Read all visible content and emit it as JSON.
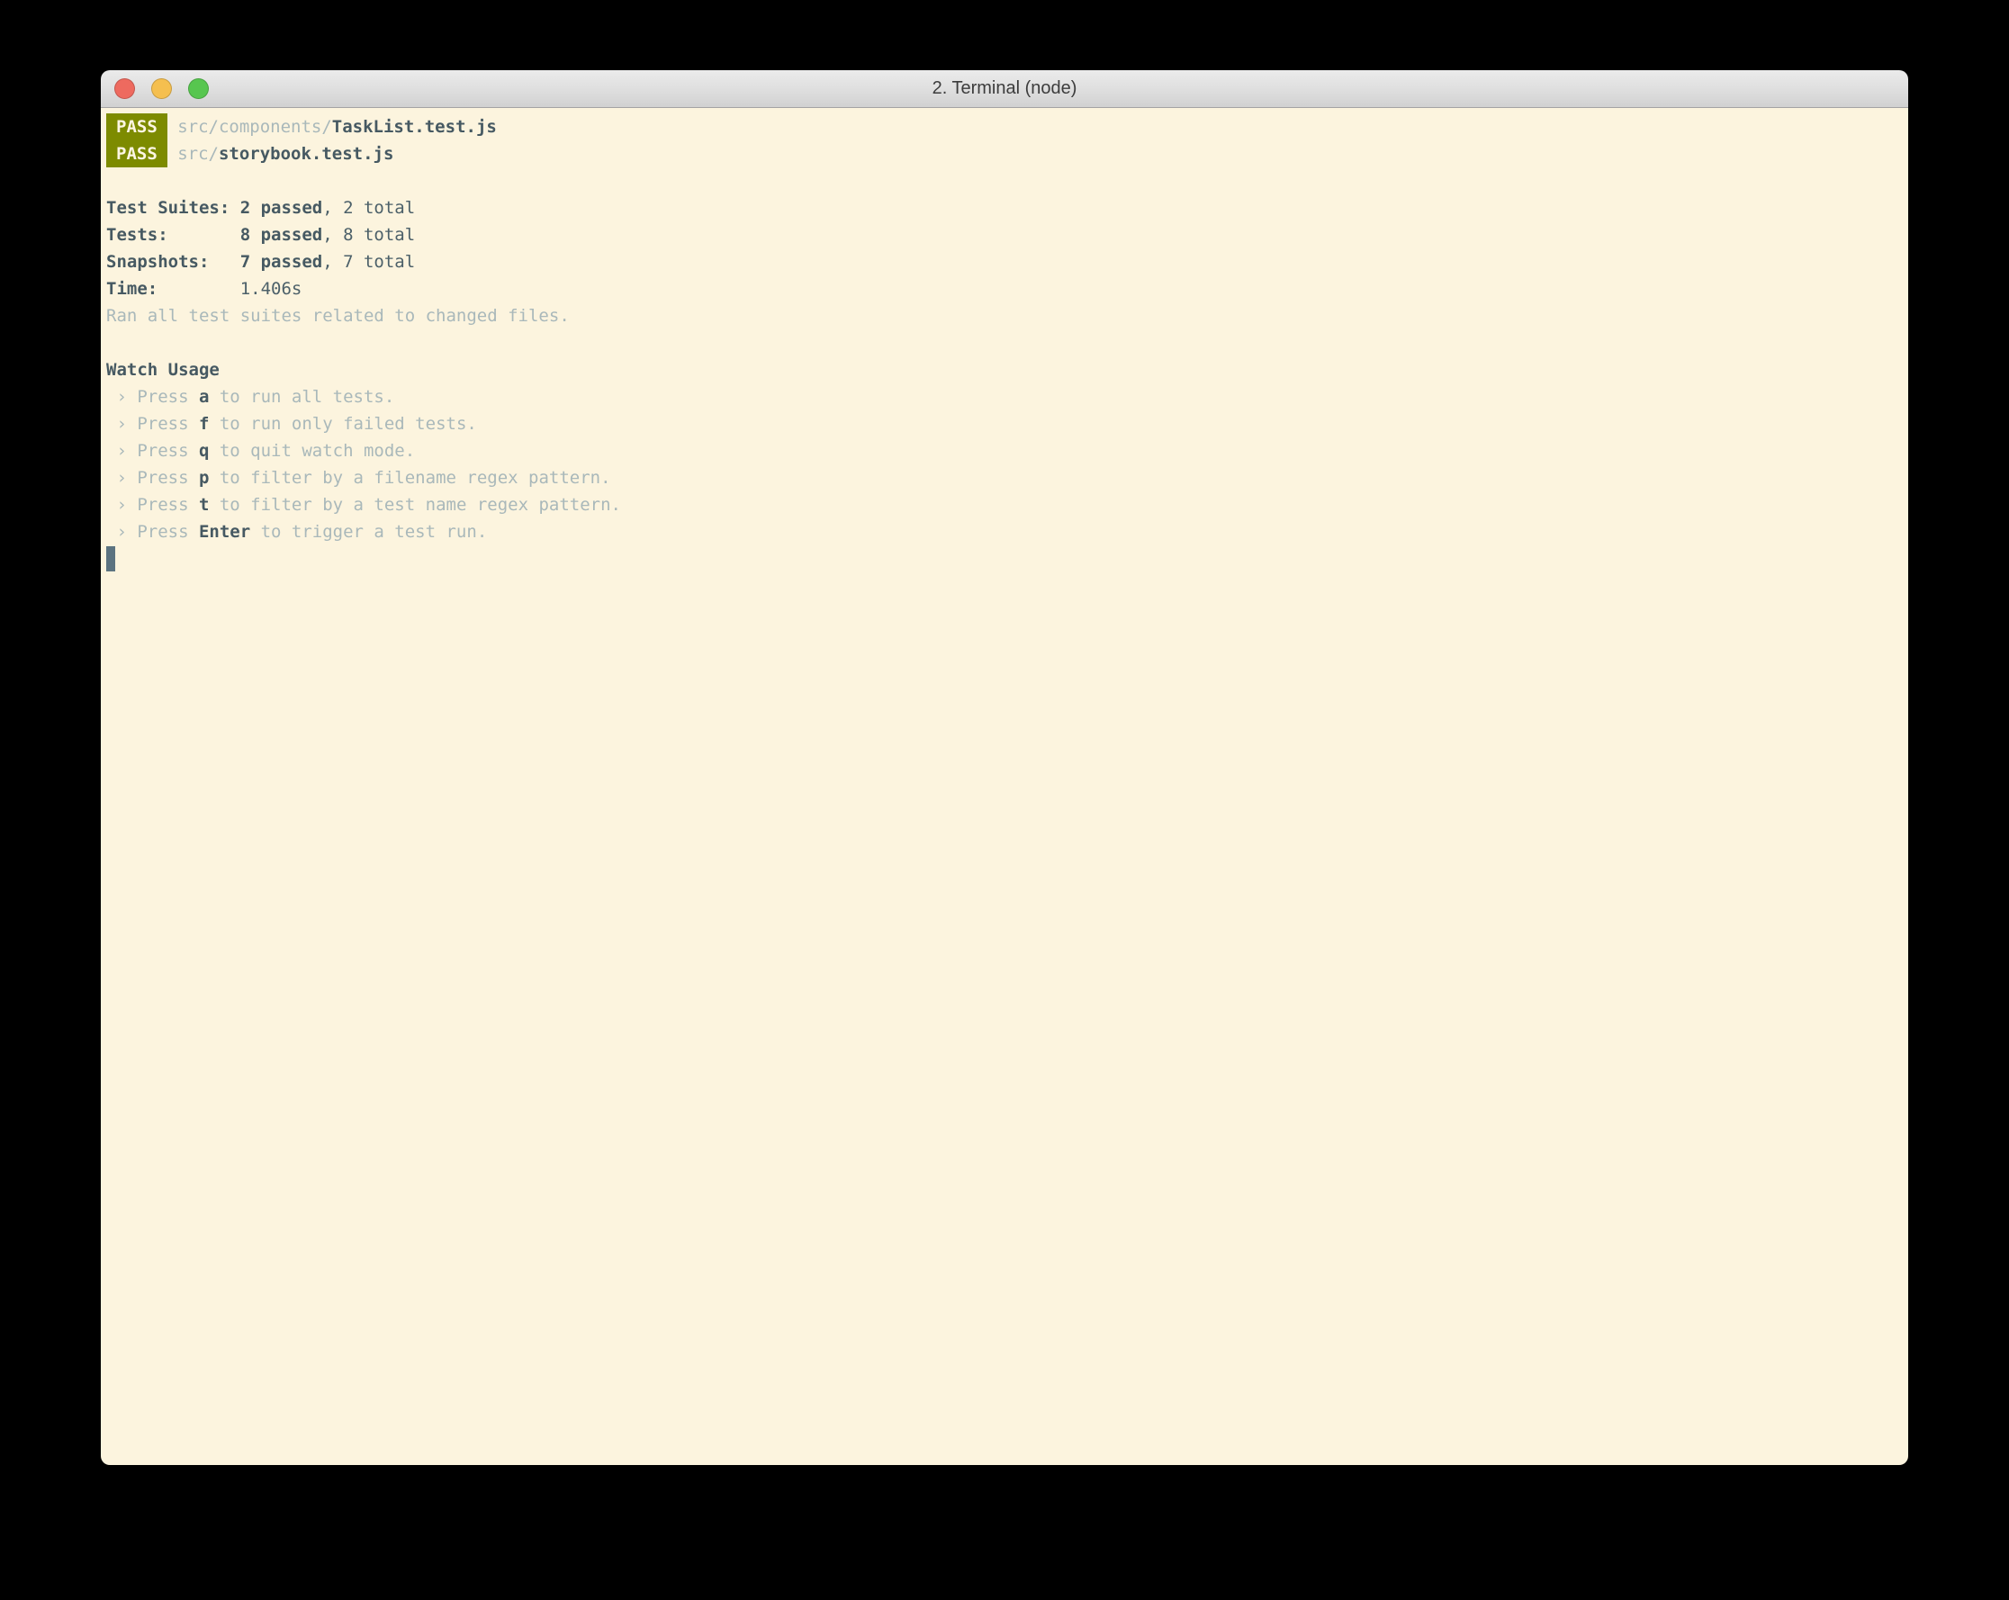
{
  "window": {
    "title": "2. Terminal (node)",
    "traffic_lights": [
      {
        "name": "close",
        "color": "#ee6a5f"
      },
      {
        "name": "minimize",
        "color": "#f5bf4f"
      },
      {
        "name": "zoom",
        "color": "#57c64f"
      }
    ]
  },
  "colors": {
    "desktop_bg": "#000000",
    "titlebar_top": "#ebebeb",
    "titlebar_bottom": "#d1d1d1",
    "title_text": "#3c3c3c",
    "terminal_bg": "#fcf4de",
    "pass_badge_bg": "#7d8b00",
    "pass_badge_text": "#fdf6e3",
    "text_bold_dark": "#465962",
    "text_dark": "#4c6069",
    "text_muted": "#a9b8ba",
    "cursor": "#5c7380"
  },
  "terminal": {
    "lines": [
      {
        "segments": [
          {
            "style": "badge",
            "text": "PASS"
          },
          {
            "style": "muted",
            "text": " src/components/"
          },
          {
            "style": "bold",
            "text": "TaskList.test.js"
          }
        ]
      },
      {
        "segments": [
          {
            "style": "badge",
            "text": "PASS"
          },
          {
            "style": "muted",
            "text": " src/"
          },
          {
            "style": "bold",
            "text": "storybook.test.js"
          }
        ]
      },
      {
        "segments": []
      },
      {
        "segments": [
          {
            "style": "bold",
            "text": "Test Suites: "
          },
          {
            "style": "bold",
            "text": "2 passed"
          },
          {
            "style": "dark",
            "text": ", 2 total"
          }
        ]
      },
      {
        "segments": [
          {
            "style": "bold",
            "text": "Tests:       "
          },
          {
            "style": "bold",
            "text": "8 passed"
          },
          {
            "style": "dark",
            "text": ", 8 total"
          }
        ]
      },
      {
        "segments": [
          {
            "style": "bold",
            "text": "Snapshots:   "
          },
          {
            "style": "bold",
            "text": "7 passed"
          },
          {
            "style": "dark",
            "text": ", 7 total"
          }
        ]
      },
      {
        "segments": [
          {
            "style": "bold",
            "text": "Time:        "
          },
          {
            "style": "dark",
            "text": "1.406s"
          }
        ]
      },
      {
        "segments": [
          {
            "style": "muted",
            "text": "Ran all test suites related to changed files."
          }
        ]
      },
      {
        "segments": []
      },
      {
        "segments": [
          {
            "style": "bold",
            "text": "Watch Usage"
          }
        ]
      },
      {
        "segments": [
          {
            "style": "muted",
            "text": " › Press "
          },
          {
            "style": "bold",
            "text": "a"
          },
          {
            "style": "muted",
            "text": " to run all tests."
          }
        ]
      },
      {
        "segments": [
          {
            "style": "muted",
            "text": " › Press "
          },
          {
            "style": "bold",
            "text": "f"
          },
          {
            "style": "muted",
            "text": " to run only failed tests."
          }
        ]
      },
      {
        "segments": [
          {
            "style": "muted",
            "text": " › Press "
          },
          {
            "style": "bold",
            "text": "q"
          },
          {
            "style": "muted",
            "text": " to quit watch mode."
          }
        ]
      },
      {
        "segments": [
          {
            "style": "muted",
            "text": " › Press "
          },
          {
            "style": "bold",
            "text": "p"
          },
          {
            "style": "muted",
            "text": " to filter by a filename regex pattern."
          }
        ]
      },
      {
        "segments": [
          {
            "style": "muted",
            "text": " › Press "
          },
          {
            "style": "bold",
            "text": "t"
          },
          {
            "style": "muted",
            "text": " to filter by a test name regex pattern."
          }
        ]
      },
      {
        "segments": [
          {
            "style": "muted",
            "text": " › Press "
          },
          {
            "style": "bold",
            "text": "Enter"
          },
          {
            "style": "muted",
            "text": " to trigger a test run."
          }
        ]
      },
      {
        "segments": [],
        "cursor": true
      }
    ]
  }
}
